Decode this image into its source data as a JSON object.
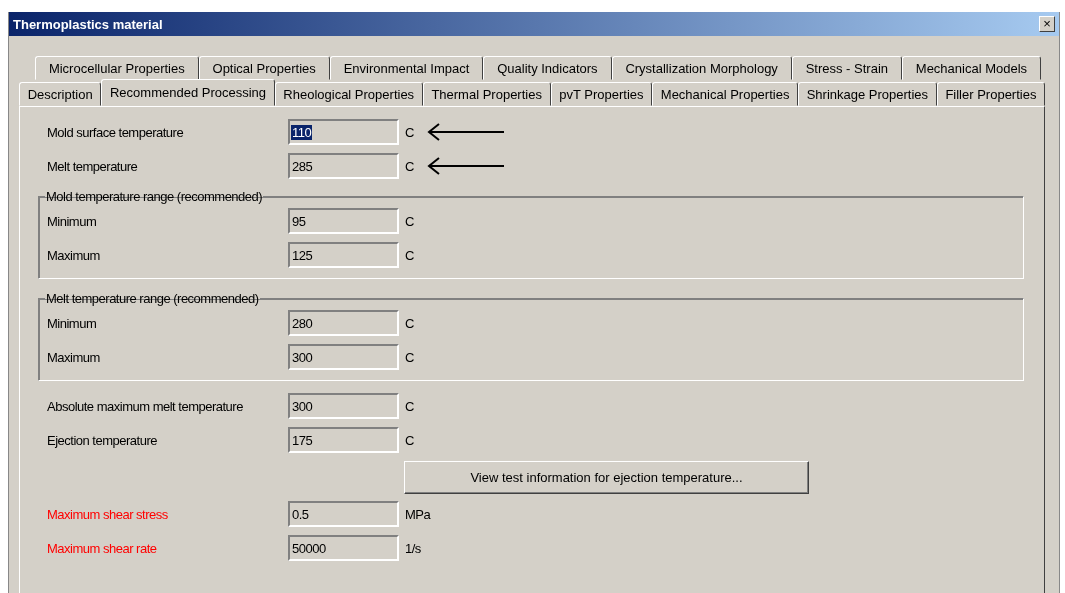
{
  "window": {
    "title": "Thermoplastics material",
    "close": "×"
  },
  "tab_rows": [
    [
      {
        "label": "Microcellular Properties",
        "selected": false
      },
      {
        "label": "Optical Properties",
        "selected": false
      },
      {
        "label": "Environmental Impact",
        "selected": false
      },
      {
        "label": "Quality Indicators",
        "selected": false
      },
      {
        "label": "Crystallization Morphology",
        "selected": false
      },
      {
        "label": "Stress - Strain",
        "selected": false
      },
      {
        "label": "Mechanical Models",
        "selected": false
      }
    ],
    [
      {
        "label": "Description",
        "selected": false
      },
      {
        "label": "Recommended Processing",
        "selected": true
      },
      {
        "label": "Rheological Properties",
        "selected": false
      },
      {
        "label": "Thermal Properties",
        "selected": false
      },
      {
        "label": "pvT Properties",
        "selected": false
      },
      {
        "label": "Mechanical Properties",
        "selected": false
      },
      {
        "label": "Shrinkage Properties",
        "selected": false
      },
      {
        "label": "Filler Properties",
        "selected": false
      }
    ]
  ],
  "rows": [
    {
      "kind": "field",
      "label": "Mold surface temperature",
      "value": "110",
      "unit": "C",
      "highlighted": true,
      "arrow": true
    },
    {
      "kind": "field",
      "label": "Melt temperature",
      "value": "285",
      "unit": "C",
      "highlighted": false,
      "arrow": true
    },
    {
      "kind": "group",
      "title": "Mold temperature range (recommended)",
      "fields": [
        {
          "label": "Minimum",
          "value": "95",
          "unit": "C"
        },
        {
          "label": "Maximum",
          "value": "125",
          "unit": "C"
        }
      ]
    },
    {
      "kind": "group",
      "title": "Melt temperature range (recommended)",
      "fields": [
        {
          "label": "Minimum",
          "value": "280",
          "unit": "C"
        },
        {
          "label": "Maximum",
          "value": "300",
          "unit": "C"
        }
      ]
    },
    {
      "kind": "field",
      "label": "Absolute maximum melt temperature",
      "value": "300",
      "unit": "C",
      "highlighted": false,
      "arrow": false
    },
    {
      "kind": "field",
      "label": "Ejection temperature",
      "value": "175",
      "unit": "C",
      "highlighted": false,
      "arrow": false
    },
    {
      "kind": "button",
      "label": "View test information for ejection temperature..."
    },
    {
      "kind": "field",
      "label": "Maximum shear stress",
      "value": "0.5",
      "unit": "MPa",
      "highlighted": false,
      "arrow": false,
      "color": "#ff0000"
    },
    {
      "kind": "field",
      "label": "Maximum shear rate",
      "value": "50000",
      "unit": "1/s",
      "highlighted": false,
      "arrow": false,
      "color": "#ff0000"
    }
  ]
}
